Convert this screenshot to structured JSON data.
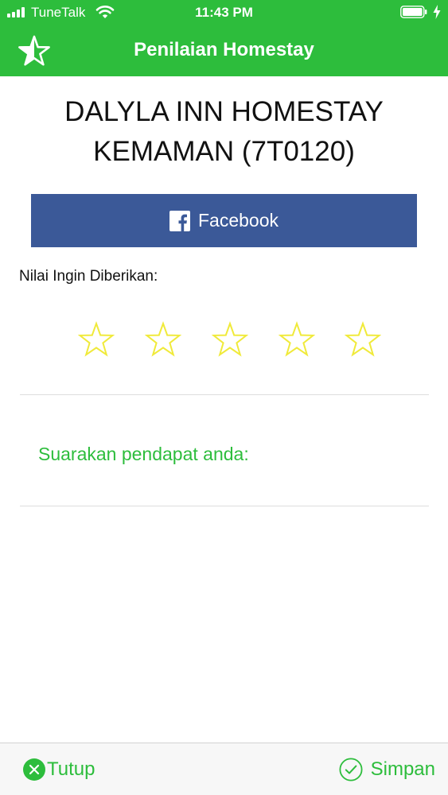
{
  "status_bar": {
    "carrier": "TuneTalk",
    "time": "11:43 PM",
    "signal_bars": 4
  },
  "header": {
    "title": "Penilaian Homestay",
    "icon": "star-outline-icon"
  },
  "homestay": {
    "name": "DALYLA INN HOMESTAY KEMAMAN (7T0120)"
  },
  "facebook_button": {
    "label": "Facebook",
    "icon": "facebook-icon",
    "color": "#3b5998"
  },
  "rating": {
    "label": "Nilai Ingin Diberikan:",
    "max_stars": 5,
    "selected": 0,
    "star_color": "#f0ea3a"
  },
  "comment": {
    "placeholder": "Suarakan pendapat anda:",
    "value": ""
  },
  "bottom_bar": {
    "close_label": "Tutup",
    "close_icon": "close-circle-icon",
    "save_label": "Simpan",
    "save_icon": "check-circle-icon"
  },
  "colors": {
    "accent": "#2dbd3c",
    "background": "#ffffff",
    "bottom_bar": "#f7f7f7"
  }
}
